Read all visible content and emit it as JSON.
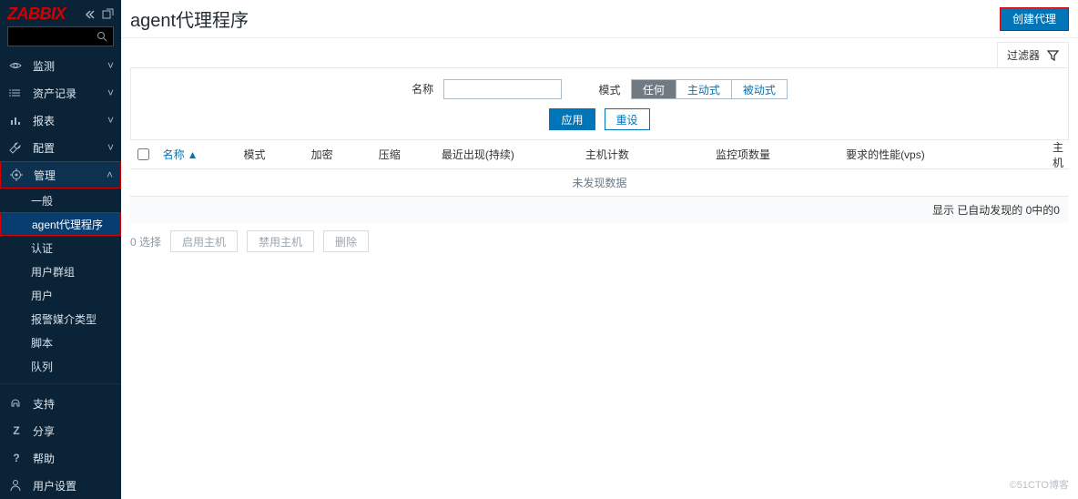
{
  "logo": "ZABBIX",
  "page_title": "agent代理程序",
  "create_button": "创建代理",
  "filter_tab": "过滤器",
  "sidebar": {
    "main_items": [
      {
        "icon": "eye",
        "label": "监测",
        "has_children": true
      },
      {
        "icon": "list",
        "label": "资产记录",
        "has_children": true
      },
      {
        "icon": "chart",
        "label": "报表",
        "has_children": true
      },
      {
        "icon": "wrench",
        "label": "配置",
        "has_children": true
      },
      {
        "icon": "gear",
        "label": "管理",
        "has_children": true
      }
    ],
    "admin_children": [
      "一般",
      "agent代理程序",
      "认证",
      "用户群组",
      "用户",
      "报警媒介类型",
      "脚本",
      "队列"
    ],
    "bottom_items": [
      {
        "icon": "support",
        "label": "支持"
      },
      {
        "icon": "z",
        "label": "分享"
      },
      {
        "icon": "help",
        "label": "帮助"
      },
      {
        "icon": "user",
        "label": "用户设置"
      }
    ]
  },
  "filter": {
    "name_label": "名称",
    "name_value": "",
    "mode_label": "模式",
    "mode_options": [
      "任何",
      "主动式",
      "被动式"
    ],
    "apply": "应用",
    "reset": "重设"
  },
  "table": {
    "headers": {
      "name": "名称",
      "mode": "模式",
      "encryption": "加密",
      "compression": "压缩",
      "last_seen": "最近出现(持续)",
      "host_count": "主机计数",
      "item_count": "监控项数量",
      "required_perf": "要求的性能(vps)",
      "host": "主机"
    },
    "empty": "未发现数据",
    "summary": "显示 已自动发现的 0中的0"
  },
  "bulk": {
    "selected": "0 选择",
    "enable": "启用主机",
    "disable": "禁用主机",
    "delete": "删除"
  },
  "watermark": "©51CTO博客"
}
